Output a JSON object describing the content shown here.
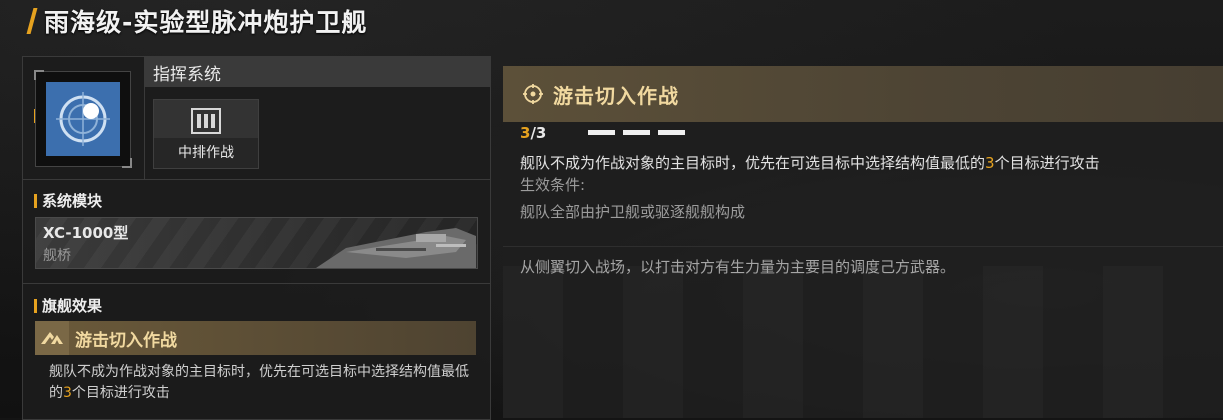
{
  "title": "雨海级-实验型脉冲炮护卫舰",
  "command": {
    "header": "指挥系统",
    "card_label": "中排作战",
    "card_icon": "column-formation-icon"
  },
  "system_module": {
    "section_label": "系统模块",
    "name": "XC-1000型",
    "type": "舰桥"
  },
  "flagship": {
    "section_label": "旗舰效果",
    "title": "游击切入作战",
    "desc_before": "舰队不成为作战对象的主目标时，优先在可选目标中选择结构值最低的",
    "desc_highlight": "3",
    "desc_after": "个目标进行攻击"
  },
  "detail": {
    "title": "游击切入作战",
    "progress_current": "3",
    "progress_total": "/3",
    "progress_segments": 3,
    "desc_before": "舰队不成为作战对象的主目标时，优先在可选目标中选择结构值最低的",
    "desc_highlight": "3",
    "desc_after": "个目标进行攻击",
    "condition_label": "生效条件:",
    "condition": "舰队全部由护卫舰或驱逐舰舰构成",
    "lore": "从侧翼切入战场，以打击对方有生力量为主要目的调度己方武器。"
  },
  "colors": {
    "accent": "#e6a21f",
    "header_gold": "#f1d9a0",
    "portrait_blue": "#3c6fae"
  }
}
